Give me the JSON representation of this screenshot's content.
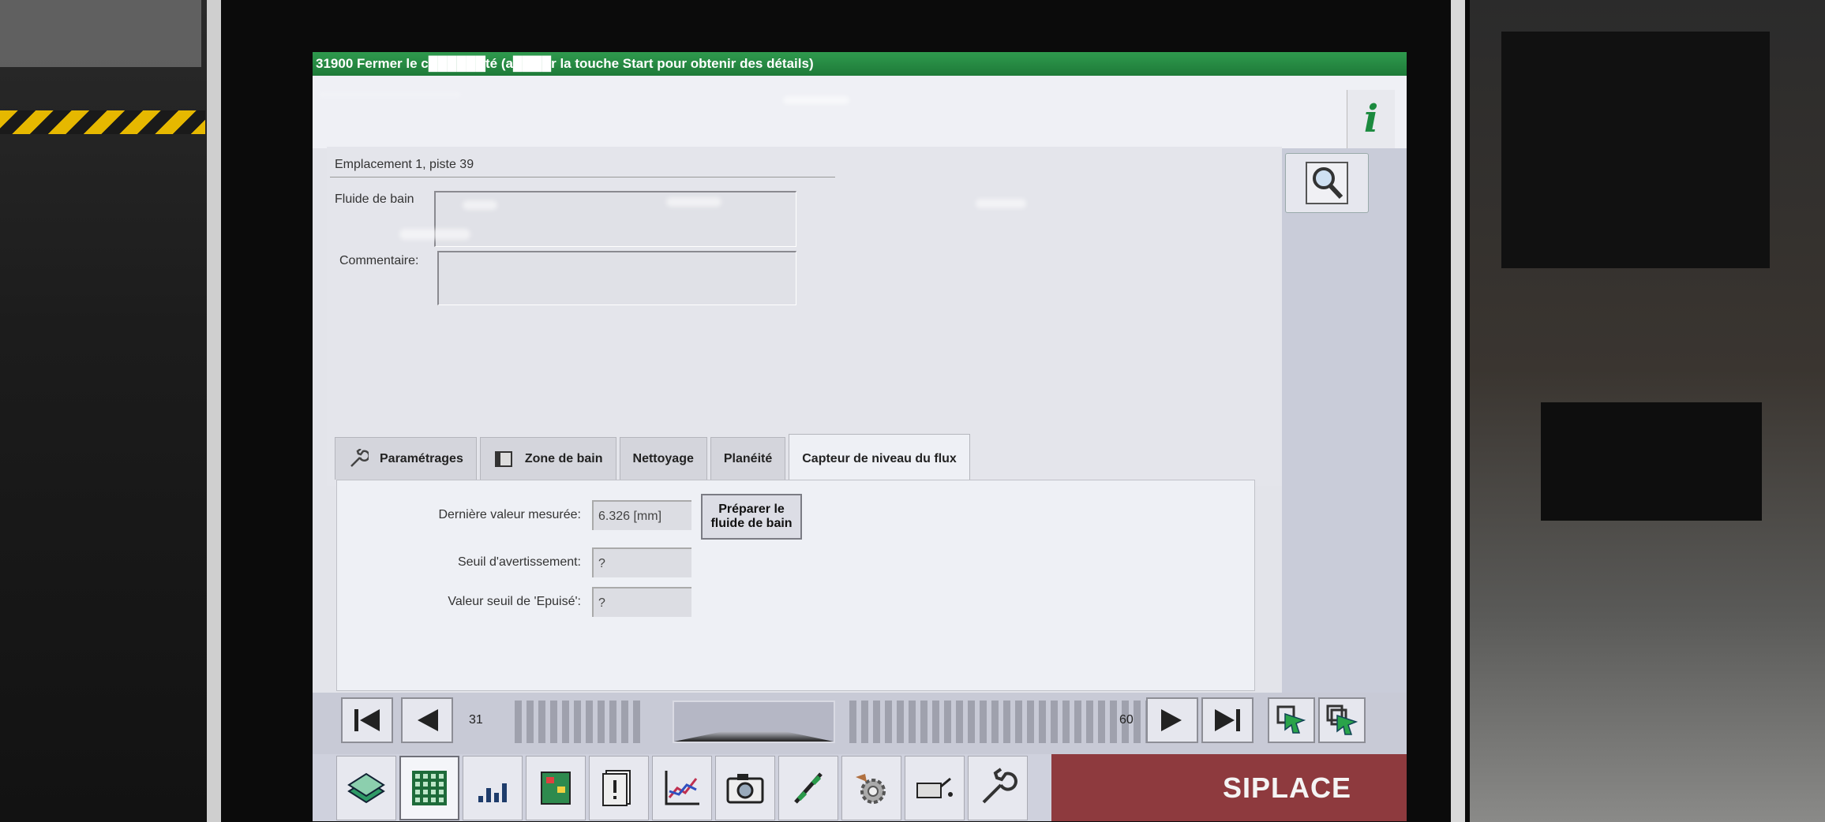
{
  "titlebar": {
    "text": "31900 Fermer le c██████té (a████r la touche Start pour obtenir des détails)"
  },
  "info_button": {
    "label": "i"
  },
  "detail": {
    "location": "Emplacement 1, piste 39",
    "bath_fluid_label": "Fluide de bain",
    "comment_label": "Commentaire:"
  },
  "tabs": [
    {
      "label": "Paramétrages"
    },
    {
      "label": "Zone de bain"
    },
    {
      "label": "Nettoyage"
    },
    {
      "label": "Planéité"
    },
    {
      "label": "Capteur de niveau du flux"
    }
  ],
  "sensor": {
    "last_value_label": "Dernière valeur mesurée:",
    "last_value": "6.326 [mm]",
    "warning_label": "Seuil d'avertissement:",
    "warning_value": "?",
    "empty_label": "Valeur seuil de 'Epuisé':",
    "empty_value": "?",
    "prepare_button": "Préparer le fluide de bain"
  },
  "navigation": {
    "page_start": "31",
    "page_end": "60"
  },
  "brand": {
    "name": "SIPLACE",
    "color": "#8e3a3e"
  },
  "colors": {
    "titlebar": "#1e7a38",
    "accent_green": "#1b8a3e"
  }
}
